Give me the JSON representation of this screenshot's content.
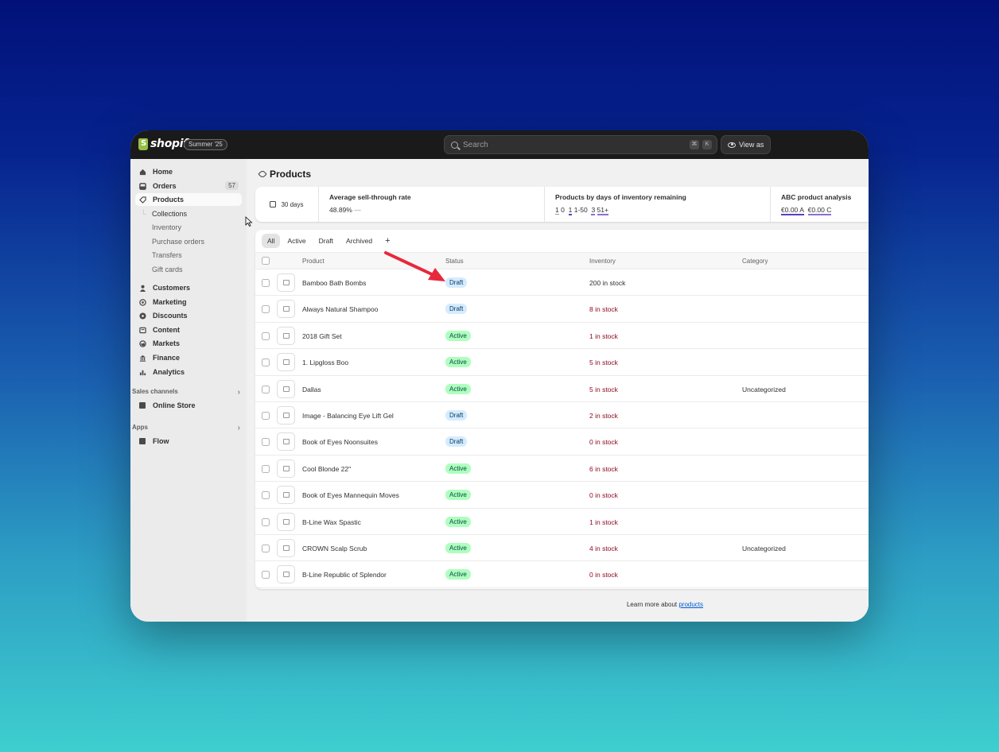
{
  "app": {
    "brand": "shopify",
    "edition": "Summer '25"
  },
  "topbar": {
    "search_placeholder": "Search",
    "shortcut_keys": [
      "⌘",
      "K"
    ],
    "view_as": "View as"
  },
  "sidebar": {
    "items": [
      {
        "label": "Home",
        "icon": "home-icon"
      },
      {
        "label": "Orders",
        "icon": "inbox-icon",
        "badge": "57"
      },
      {
        "label": "Products",
        "icon": "tag-icon",
        "active": true
      }
    ],
    "product_subitems": [
      "Collections",
      "Inventory",
      "Purchase orders",
      "Transfers",
      "Gift cards"
    ],
    "items2": [
      {
        "label": "Customers",
        "icon": "person-icon"
      },
      {
        "label": "Marketing",
        "icon": "target-icon"
      },
      {
        "label": "Discounts",
        "icon": "discount-icon"
      },
      {
        "label": "Content",
        "icon": "content-icon"
      },
      {
        "label": "Markets",
        "icon": "globe-icon"
      },
      {
        "label": "Finance",
        "icon": "bank-icon"
      },
      {
        "label": "Analytics",
        "icon": "bar-chart-icon"
      }
    ],
    "sales_channels_heading": "Sales channels",
    "online_store": "Online Store",
    "apps_heading": "Apps",
    "flow": "Flow"
  },
  "page": {
    "title": "Products"
  },
  "metrics": {
    "range": "30 days",
    "sell_through": {
      "title": "Average sell-through rate",
      "value": "48.89%",
      "trend": "—"
    },
    "days_inventory": {
      "title": "Products by days of inventory remaining",
      "v1": "1",
      "l1": "0",
      "v2": "1",
      "l2": "1-50",
      "v3": "3",
      "l3": "51+"
    },
    "abc": {
      "title": "ABC product analysis",
      "a_val": "€0.00",
      "a": "A",
      "c_val": "€0.00",
      "c": "C"
    }
  },
  "tabs": [
    "All",
    "Active",
    "Draft",
    "Archived",
    "+"
  ],
  "table": {
    "headers": [
      "Product",
      "Status",
      "Inventory",
      "Category"
    ],
    "rows": [
      {
        "product": "Bamboo Bath Bombs",
        "status": "Draft",
        "inventory": "200 in stock",
        "category": ""
      },
      {
        "product": "Always Natural Shampoo",
        "status": "Draft",
        "inventory": "8 in stock",
        "category": ""
      },
      {
        "product": "2018 Gift Set",
        "status": "Active",
        "inventory": "1 in stock",
        "category": ""
      },
      {
        "product": "1. Lipgloss Boo",
        "status": "Active",
        "inventory": "5 in stock",
        "category": ""
      },
      {
        "product": "Dallas",
        "status": "Active",
        "inventory": "5 in stock",
        "category": "Uncategorized"
      },
      {
        "product": "Image - Balancing Eye Lift Gel",
        "status": "Draft",
        "inventory": "2 in stock",
        "category": ""
      },
      {
        "product": "Book of Eyes Noonsuites",
        "status": "Draft",
        "inventory": "0 in stock",
        "category": ""
      },
      {
        "product": "Cool Blonde 22\"",
        "status": "Active",
        "inventory": "6 in stock",
        "category": ""
      },
      {
        "product": "Book of Eyes Mannequin Moves",
        "status": "Active",
        "inventory": "0 in stock",
        "category": ""
      },
      {
        "product": "B-Line Wax Spastic",
        "status": "Active",
        "inventory": "1 in stock",
        "category": ""
      },
      {
        "product": "CROWN Scalp Scrub",
        "status": "Active",
        "inventory": "4 in stock",
        "category": "Uncategorized"
      },
      {
        "product": "B-Line Republic of Splendor",
        "status": "Active",
        "inventory": "0 in stock",
        "category": ""
      }
    ]
  },
  "footer": {
    "text": "Learn more about ",
    "link": "products"
  },
  "colors": {
    "draft_pill": "#d5ebff",
    "active_pill": "#affebf",
    "annotation_arrow": "#e8283c",
    "low_stock": "#8e0b21"
  }
}
